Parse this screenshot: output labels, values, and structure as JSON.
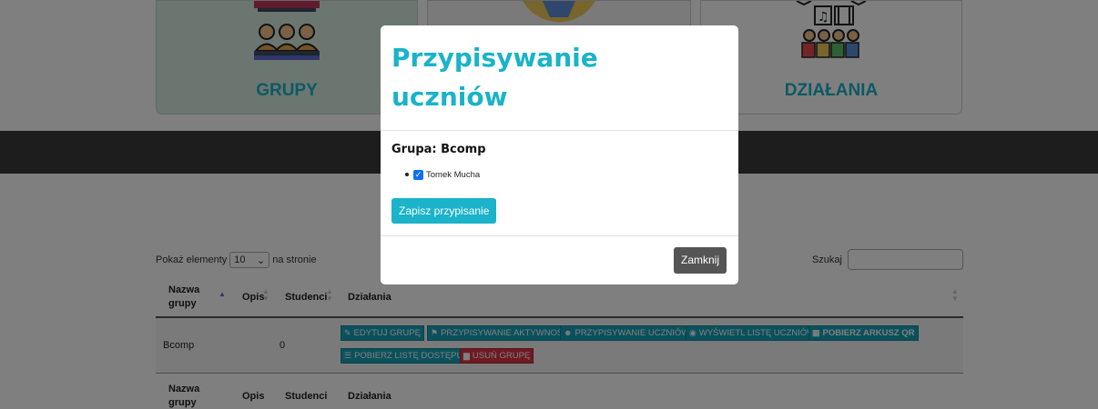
{
  "cards": {
    "groups": {
      "label": "GRUPY"
    },
    "students": {
      "label": ""
    },
    "activities": {
      "label": "DZIAŁANIA"
    }
  },
  "table_controls": {
    "length_prefix": "Pokaż elementy",
    "length_value": "10",
    "length_suffix": "na stronie",
    "search_label": "Szukaj",
    "search_value": ""
  },
  "table": {
    "columns": [
      "Nazwa grupy",
      "Opis",
      "Studenci",
      "Działania"
    ],
    "rows": [
      {
        "name": "Bcomp",
        "description": "",
        "students": "0"
      }
    ],
    "actions": [
      {
        "label": "EDYTUJ GRUPĘ",
        "icon": "edit-icon"
      },
      {
        "label": "PRZYPISYWANIE AKTYWNOŚCI",
        "icon": "activity-icon"
      },
      {
        "label": "PRZYPISYWANIE UCZNIÓW",
        "icon": "users-icon"
      },
      {
        "label": "WYŚWIETL LISTĘ UCZNIÓW",
        "icon": "eye-icon"
      },
      {
        "label": "POBIERZ ARKUSZ QR",
        "icon": "qr-icon"
      },
      {
        "label": "POBIERZ LISTĘ DOSTĘPU",
        "icon": "list-icon"
      },
      {
        "label": "USUŃ GRUPĘ",
        "icon": "trash-icon"
      }
    ]
  },
  "modal": {
    "title": "Przypisywanie uczniów",
    "group_label": "Grupa: Bcomp",
    "students": [
      {
        "name": "Tomek Mucha",
        "checked": true
      }
    ],
    "save_label": "Zapisz przypisanie",
    "close_label": "Zamknij"
  },
  "colors": {
    "accent": "#1ab3c9",
    "danger": "#dc3545",
    "checkbox": "#0d6efd",
    "dark_button": "#555555"
  }
}
